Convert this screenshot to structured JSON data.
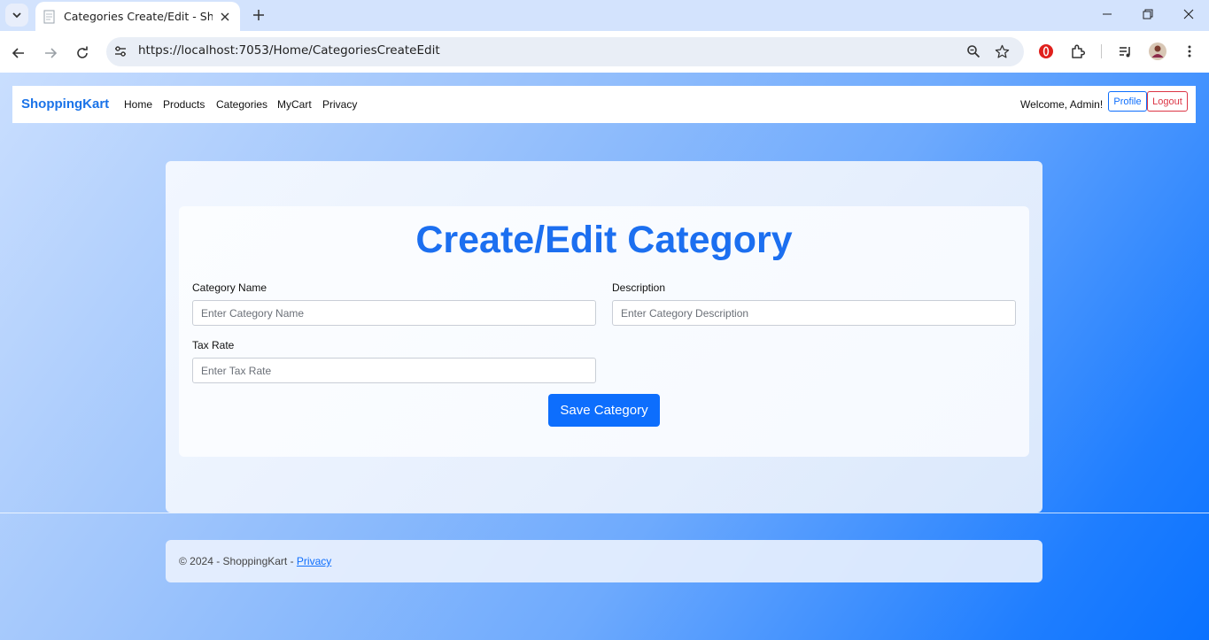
{
  "browser": {
    "tab_title": "Categories Create/Edit - ShoppingKart",
    "url": "https://localhost:7053/Home/CategoriesCreateEdit",
    "icons": [
      "tab-search-icon",
      "close-icon",
      "plus-icon",
      "minimize-icon",
      "restore-icon",
      "close-window-icon",
      "back-arrow-icon",
      "forward-arrow-icon",
      "reload-icon",
      "site-info-icon",
      "zoom-icon",
      "star-icon",
      "opera-extension-icon",
      "puzzle-extensions-icon",
      "media-controls-icon",
      "profile-avatar-icon",
      "kebab-menu-icon"
    ]
  },
  "navbar": {
    "brand": "ShoppingKart",
    "links": [
      "Home",
      "Products",
      "Categories",
      "MyCart",
      "Privacy"
    ],
    "welcome": "Welcome, Admin!",
    "profile_label": "Profile",
    "logout_label": "Logout"
  },
  "form": {
    "title": "Create/Edit Category",
    "name_label": "Category Name",
    "name_placeholder": "Enter Category Name",
    "description_label": "Description",
    "description_placeholder": "Enter Category Description",
    "tax_label": "Tax Rate",
    "tax_placeholder": "Enter Tax Rate",
    "save_label": "Save Category"
  },
  "footer": {
    "text": "© 2024 - ShoppingKart - ",
    "privacy_link": "Privacy"
  },
  "colors": {
    "brand": "#1a73e8",
    "primary": "#0d6efd",
    "danger": "#dc3545",
    "title": "#1c6ff0"
  }
}
